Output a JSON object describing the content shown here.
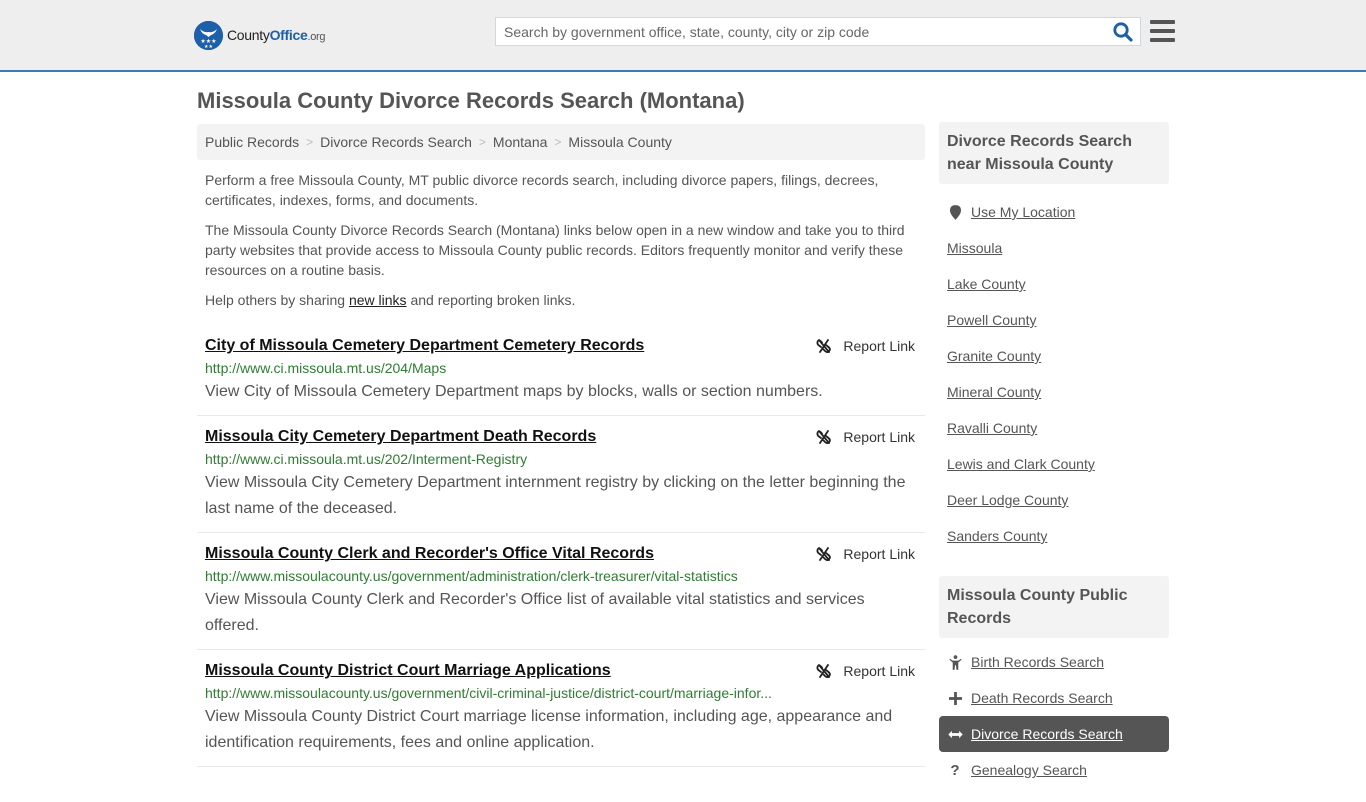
{
  "header": {
    "logo": {
      "county": "County",
      "office": "Office",
      "org": ".org"
    },
    "search": {
      "placeholder": "Search by government office, state, county, city or zip code",
      "value": ""
    }
  },
  "page": {
    "title": "Missoula County Divorce Records Search (Montana)"
  },
  "breadcrumb": [
    {
      "label": "Public Records"
    },
    {
      "label": "Divorce Records Search"
    },
    {
      "label": "Montana"
    },
    {
      "label": "Missoula County"
    }
  ],
  "intro": {
    "p1": "Perform a free Missoula County, MT public divorce records search, including divorce papers, filings, decrees, certificates, indexes, forms, and documents.",
    "p2": "The Missoula County Divorce Records Search (Montana) links below open in a new window and take you to third party websites that provide access to Missoula County public records. Editors frequently monitor and verify these resources on a routine basis.",
    "p3_before": "Help others by sharing ",
    "p3_link": "new links",
    "p3_after": " and reporting broken links."
  },
  "report_label": "Report Link",
  "records": [
    {
      "title": "City of Missoula Cemetery Department Cemetery Records",
      "url": "http://www.ci.missoula.mt.us/204/Maps",
      "desc": "View City of Missoula Cemetery Department maps by blocks, walls or section numbers."
    },
    {
      "title": "Missoula City Cemetery Department Death Records",
      "url": "http://www.ci.missoula.mt.us/202/Interment-Registry",
      "desc": "View Missoula City Cemetery Department internment registry by clicking on the letter beginning the last name of the deceased."
    },
    {
      "title": "Missoula County Clerk and Recorder's Office Vital Records",
      "url": "http://www.missoulacounty.us/government/administration/clerk-treasurer/vital-statistics",
      "desc": "View Missoula County Clerk and Recorder's Office list of available vital statistics and services offered."
    },
    {
      "title": "Missoula County District Court Marriage Applications",
      "url": "http://www.missoulacounty.us/government/civil-criminal-justice/district-court/marriage-infor...",
      "desc": "View Missoula County District Court marriage license information, including age, appearance and identification requirements, fees and online application."
    }
  ],
  "sidebar": {
    "nearby": {
      "heading": "Divorce Records Search near Missoula County",
      "use_location": "Use My Location",
      "items": [
        "Missoula",
        "Lake County",
        "Powell County",
        "Granite County",
        "Mineral County",
        "Ravalli County",
        "Lewis and Clark County",
        "Deer Lodge County",
        "Sanders County"
      ]
    },
    "public_records": {
      "heading": "Missoula County Public Records",
      "items": [
        {
          "label": "Birth Records Search",
          "icon": "child-icon"
        },
        {
          "label": "Death Records Search",
          "icon": "plus-icon"
        },
        {
          "label": "Divorce Records Search",
          "icon": "arrows-horizontal-icon",
          "active": true
        },
        {
          "label": "Genealogy Search",
          "icon": "question-icon"
        }
      ]
    }
  },
  "colors": {
    "brand": "#1d5fa8",
    "url_green": "#2e7d32",
    "active_bg": "#555555",
    "header_border": "#3a7bb0"
  }
}
